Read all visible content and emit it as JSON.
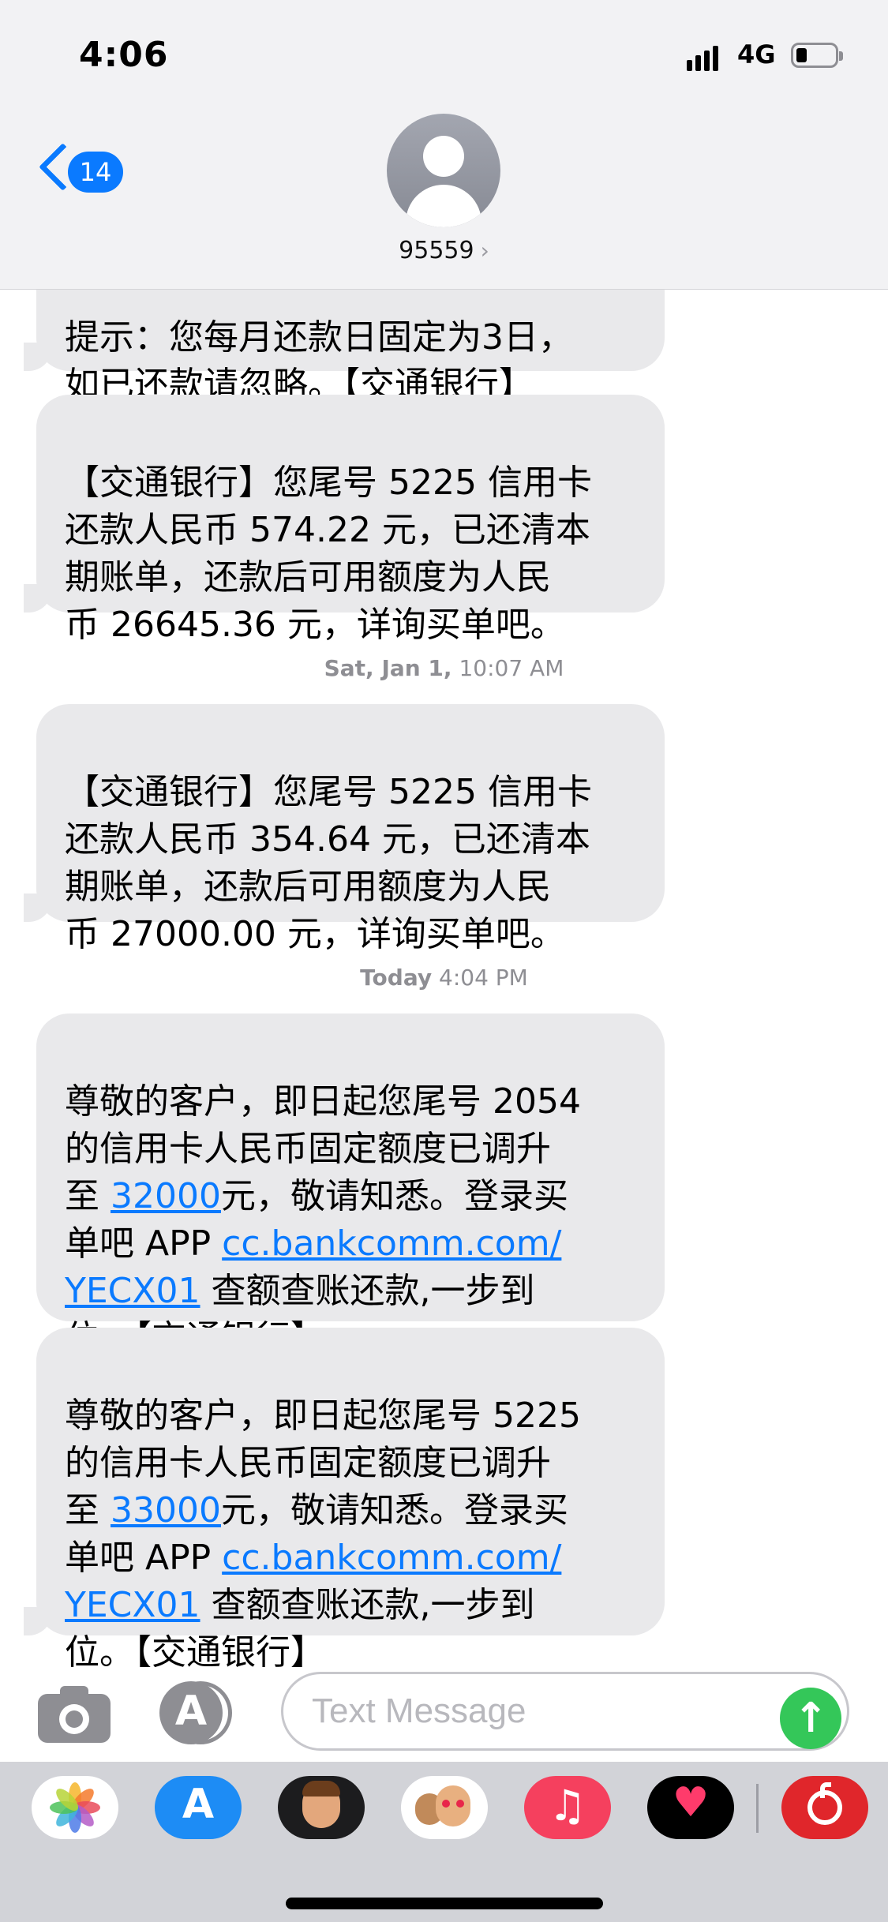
{
  "status_bar": {
    "time": "4:06",
    "network": "4G",
    "battery_level": 0.2
  },
  "header": {
    "unread_count": "14",
    "contact": "95559",
    "contact_chevron": "›"
  },
  "messages": [
    {
      "text": "提示：您每月还款日固定为3日，\n如已还款请忽略。【交通银行】"
    },
    {
      "text": "【交通银行】您尾号 5225 信用卡\n还款人民币 574.22 元，已还清本\n期账单，还款后可用额度为人民\n币 26645.36 元，详询买单吧。"
    },
    {
      "text": "【交通银行】您尾号 5225 信用卡\n还款人民币 354.64 元，已还清本\n期账单，还款后可用额度为人民\n币 27000.00 元，详询买单吧。"
    },
    {
      "pre": "尊敬的客户，即日起您尾号 2054\n的信用卡人民币固定额度已调升\n至 ",
      "amount": "32000",
      "mid": "元，敬请知悉。登录买\n单吧 APP ",
      "link1": "cc.bankcomm.com/",
      "link2": "YECX01",
      "post": " 查额查账还款,一步到\n位。【交通银行】"
    },
    {
      "pre": "尊敬的客户，即日起您尾号 5225\n的信用卡人民币固定额度已调升\n至 ",
      "amount": "33000",
      "mid": "元，敬请知悉。登录买\n单吧 APP ",
      "link1": "cc.bankcomm.com/",
      "link2": "YECX01",
      "post": " 查额查账还款,一步到\n位。【交通银行】"
    }
  ],
  "timestamps": [
    {
      "day": "Sat, Jan 1,",
      "time": "10:07 AM"
    },
    {
      "day": "Today",
      "time": "4:04 PM"
    }
  ],
  "input": {
    "placeholder": "Text Message"
  },
  "send_glyph": "↑",
  "app_drawer": {
    "apps": [
      "photos-icon",
      "app-store-icon",
      "memoji-stickers-icon",
      "animoji-icon",
      "music-icon",
      "digital-touch-icon",
      "netease-music-icon"
    ]
  },
  "colors": {
    "accent": "#0a7aff",
    "bubble": "#e9e9eb",
    "send": "#34c759"
  }
}
